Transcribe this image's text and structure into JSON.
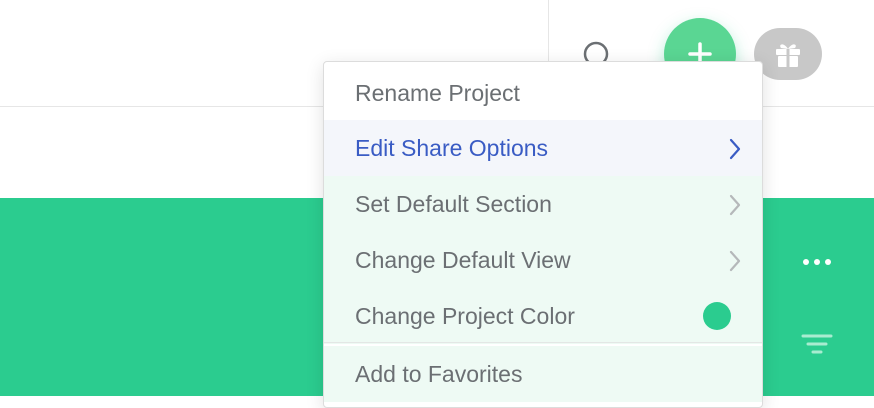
{
  "colors": {
    "accent": "#2bcc8f",
    "active": "#3a5cc4",
    "project_color": "#2bcc8f"
  },
  "toolbar": {
    "search_icon": "search-icon",
    "add_icon": "plus-icon",
    "gift_icon": "gift-icon"
  },
  "header": {
    "more_icon": "more-horizontal-icon",
    "filter_icon": "filter-icon"
  },
  "menu": {
    "items": [
      {
        "label": "Rename Project"
      },
      {
        "label": "Edit Share Options",
        "submenu": true,
        "state": "highlighted"
      },
      {
        "label": "Set Default Section",
        "submenu": true
      },
      {
        "label": "Change Default View",
        "submenu": true
      },
      {
        "label": "Change Project Color",
        "swatch": "#2bcc8f"
      },
      {
        "label": "Add to Favorites"
      }
    ]
  }
}
